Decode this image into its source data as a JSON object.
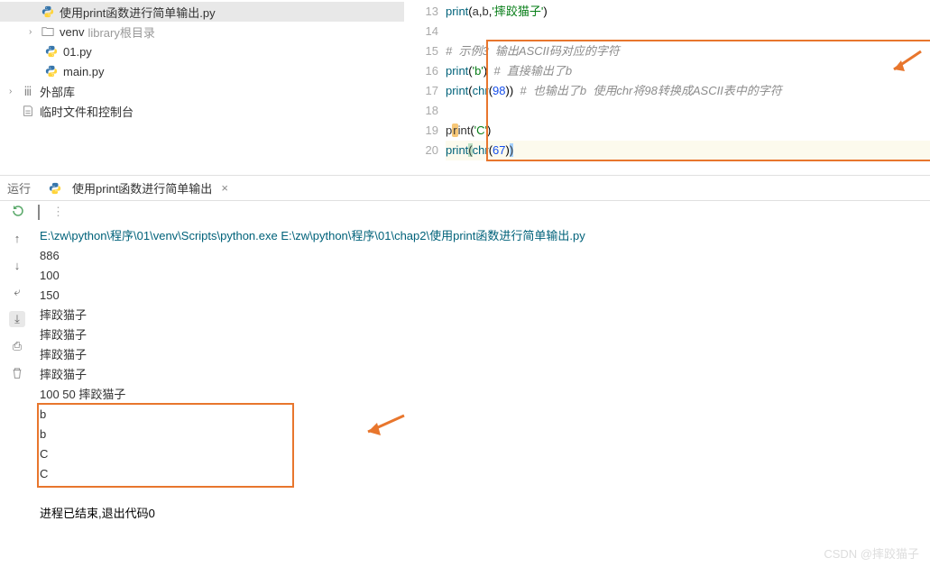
{
  "tree": {
    "file_selected": "使用print函数进行简单输出.py",
    "venv": "venv",
    "venv_hint": "library根目录",
    "file1": "01.py",
    "file2": "main.py",
    "ext_lib": "外部库",
    "scratch": "临时文件和控制台"
  },
  "editor": {
    "lines": [
      "13",
      "14",
      "15",
      "16",
      "17",
      "18",
      "19",
      "20"
    ],
    "l13_call": "print",
    "l13_a": "a",
    "l13_b": "b",
    "l13_str": "'摔跤猫子'",
    "l15_cmt": "#  示例3  输出ASCII码对应的字符",
    "l16_call": "print",
    "l16_str": "'b'",
    "l16_cmt": "#  直接输出了b",
    "l17_call": "print",
    "l17_chr": "chr",
    "l17_num": "98",
    "l17_cmt": "#  也输出了b  使用chr将98转换成ASCII表中的字符",
    "l19_call": "print",
    "l19_str": "'C'",
    "l20_call": "print",
    "l20_chr": "chr",
    "l20_num": "67"
  },
  "run": {
    "label": "运行",
    "tab": "使用print函数进行简单输出",
    "cmd": "E:\\zw\\python\\程序\\01\\venv\\Scripts\\python.exe E:\\zw\\python\\程序\\01\\chap2\\使用print函数进行简单输出.py",
    "out": [
      "886",
      "100",
      "150",
      "摔跤猫子",
      "摔跤猫子",
      "摔跤猫子",
      "摔跤猫子",
      "100 50 摔跤猫子",
      "b",
      "b",
      "C",
      "C"
    ],
    "exit": "进程已结束,退出代码0"
  },
  "watermark": "CSDN @摔跤猫子"
}
